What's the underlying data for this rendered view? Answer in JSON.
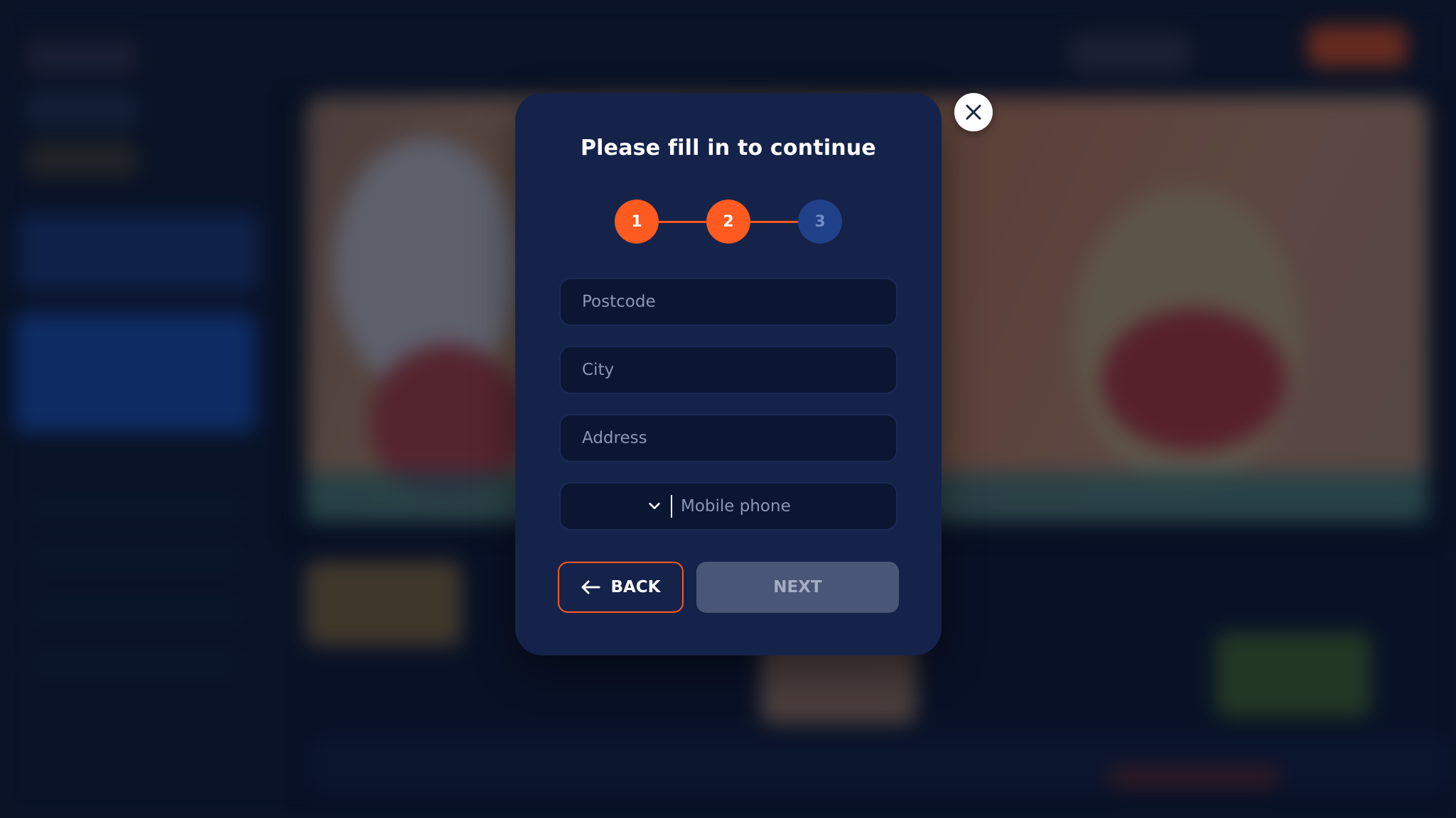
{
  "modal": {
    "title": "Please fill in to continue",
    "steps": [
      {
        "label": "1",
        "state": "done"
      },
      {
        "label": "2",
        "state": "done"
      },
      {
        "label": "3",
        "state": "todo"
      }
    ],
    "fields": {
      "postcode": {
        "placeholder": "Postcode",
        "value": ""
      },
      "city": {
        "placeholder": "City",
        "value": ""
      },
      "address": {
        "placeholder": "Address",
        "value": ""
      },
      "mobile_phone": {
        "placeholder": "Mobile phone",
        "value": ""
      }
    },
    "back_label": "BACK",
    "next_label": "NEXT"
  },
  "icons": {
    "close": "close-icon",
    "phone_code_dropdown": "chevron-down-icon",
    "back": "arrow-left-icon"
  },
  "colors": {
    "accent": "#ff5a1f",
    "modal_bg": "#15234a",
    "field_bg": "#0b1633",
    "step_todo": "#21408a",
    "next_disabled": "#4a5677"
  }
}
